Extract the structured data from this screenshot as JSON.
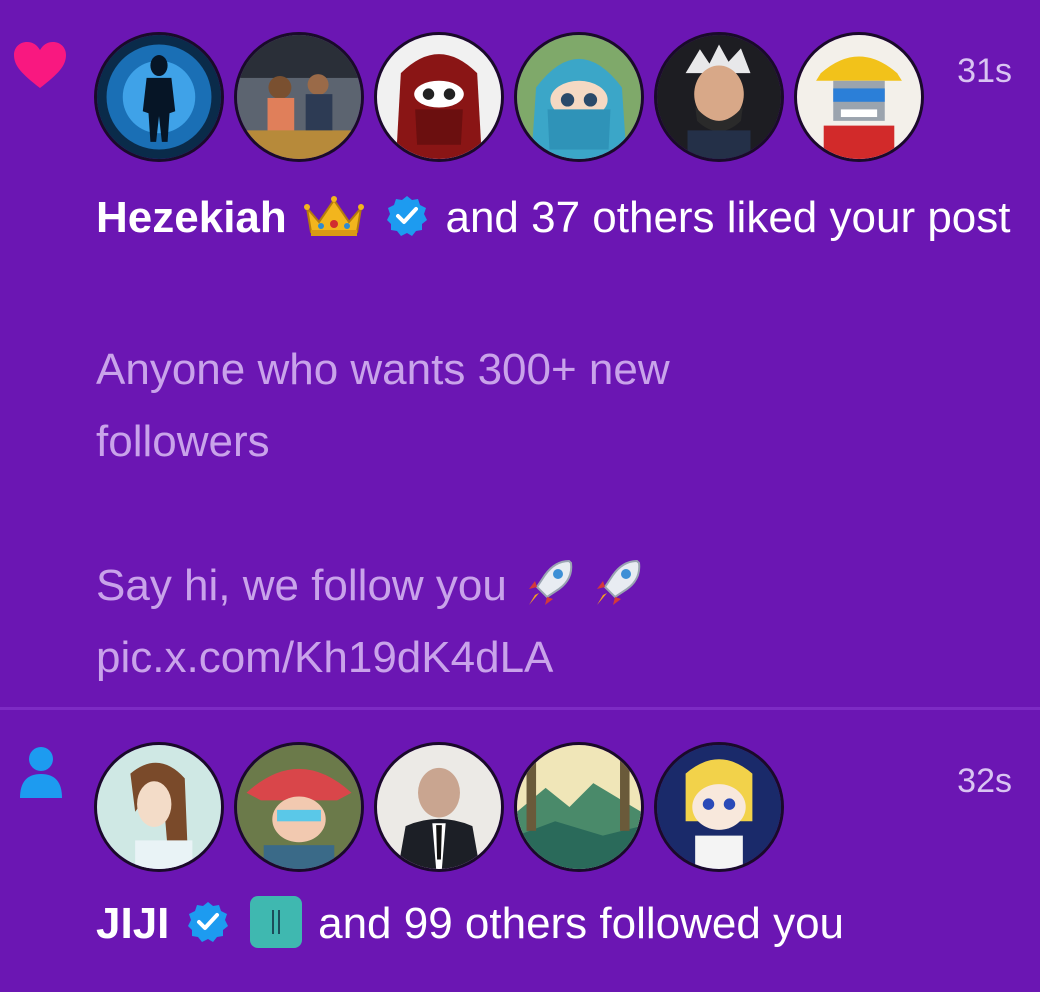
{
  "notifications": [
    {
      "type": "like",
      "type_icon": "heart-icon",
      "icon_color": "#f91880",
      "timestamp": "31s",
      "avatars": [
        "avatar-blue-silhouette",
        "avatar-people-photo",
        "avatar-red-hijab",
        "avatar-teal-niqab",
        "avatar-white-hair-man",
        "avatar-yellow-hat-robot"
      ],
      "user_name": "Hezekiah",
      "user_badges": [
        "crown-emoji",
        "verified-badge"
      ],
      "action_text": "and 37 others liked your post",
      "post_lines": [
        "Anyone who wants 300+ new",
        "followers",
        "",
        "Say hi, we follow you",
        "pic.x.com/Kh19dK4dLA"
      ],
      "post_emoji": "rocket-emoji"
    },
    {
      "type": "follow",
      "type_icon": "person-icon",
      "icon_color": "#1d9bf0",
      "timestamp": "32s",
      "avatars": [
        "avatar-braided-hair",
        "avatar-cowboy-hat",
        "avatar-suit-man",
        "avatar-forest-landscape",
        "avatar-blonde-cartoon"
      ],
      "user_name": "JIJI",
      "user_badges": [
        "verified-badge",
        "app-badge"
      ],
      "action_text": "and 99 others followed you"
    }
  ],
  "colors": {
    "background": "#6b16b3",
    "post_text": "#c9a3ea",
    "timestamp": "#d9c4f2",
    "verified": "#1d9bf0"
  }
}
